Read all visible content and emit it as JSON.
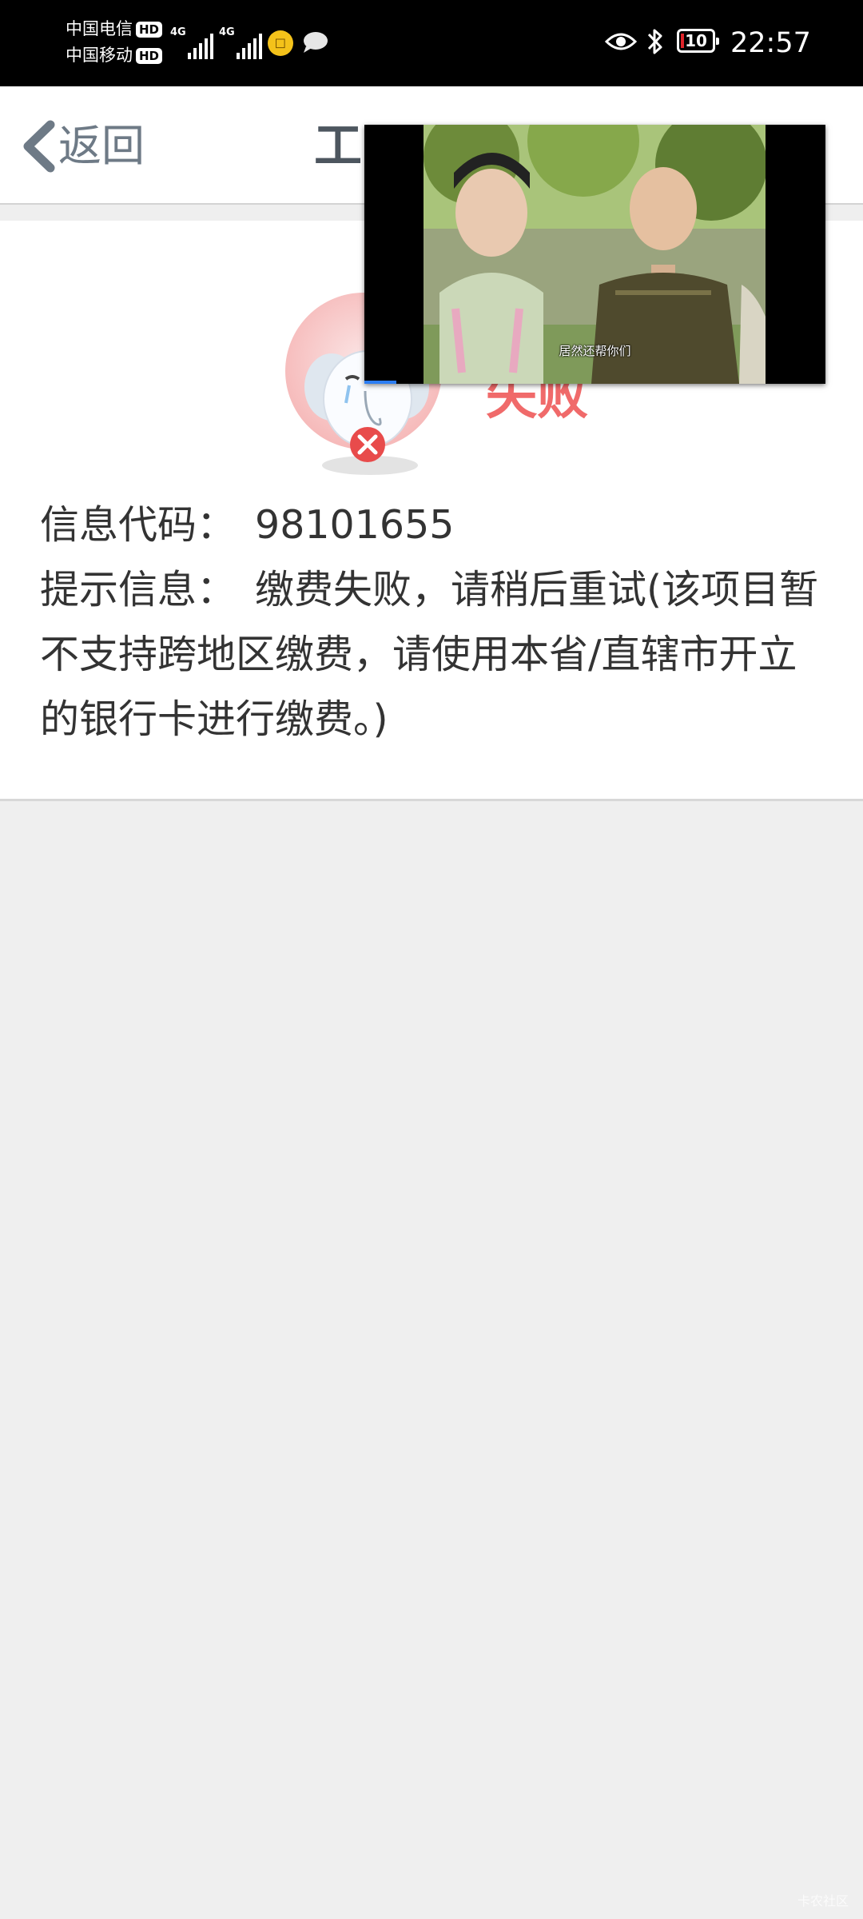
{
  "status_bar": {
    "carrier_1": "中国电信",
    "carrier_2": "中国移动",
    "hd_badge": "HD",
    "network_1": "4G",
    "network_2": "4G",
    "battery_level": "10",
    "time": "22:57",
    "icons": [
      "hd-icon",
      "signal-icon",
      "notification-icon",
      "chat-icon",
      "eye-icon",
      "bluetooth-icon",
      "battery-icon"
    ]
  },
  "nav": {
    "back_label": "返回",
    "title": "工",
    "icon": "chevron-left-icon"
  },
  "result": {
    "status_title": "失败",
    "icon": "sad-elephant-error-icon",
    "code_label": "信息代码：",
    "code_value": "98101655",
    "message_label": "提示信息：",
    "message_value": "缴费失败，请稍后重试(该项目暂不支持跨地区缴费，请使用本省/直辖市开立的银行卡进行缴费。)"
  },
  "video_popup": {
    "subtitle": "居然还帮你们",
    "progress": 0.07
  },
  "watermark": "卡农社区",
  "colors": {
    "status_bar_bg": "#000000",
    "nav_text": "#6e7a86",
    "fail_red": "#f06a6a",
    "page_bg": "#efefef"
  }
}
